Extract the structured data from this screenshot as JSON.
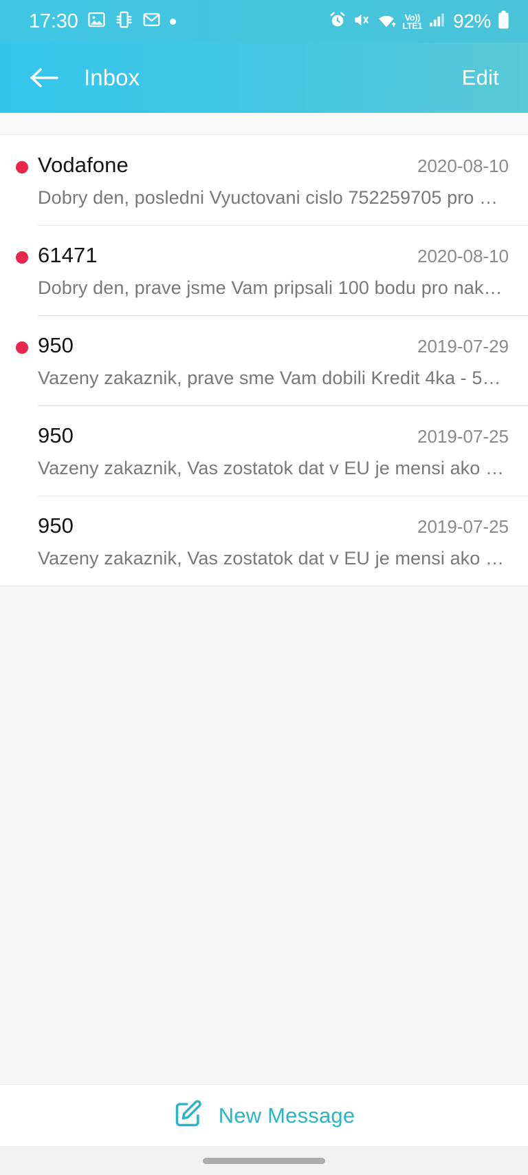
{
  "status_bar": {
    "time": "17:30",
    "left_icons": [
      "image-icon",
      "screen-mirror-icon",
      "gmail-icon",
      "dot-icon"
    ],
    "right_icons": [
      "alarm-icon",
      "mute-vibrate-icon",
      "wifi-icon",
      "volte-icon",
      "signal-bars-icon"
    ],
    "volte_line1": "Vo))",
    "volte_line2": "LTE1",
    "battery_percent": "92%",
    "background_color": "#3fc6e4",
    "foreground_color": "#ffffff"
  },
  "app_bar": {
    "back_icon": "arrow-left-icon",
    "title": "Inbox",
    "edit_label": "Edit",
    "gradient_start": "#35c5ec",
    "gradient_end": "#58c9d6"
  },
  "messages": [
    {
      "sender": "Vodafone",
      "date": "2020-08-10",
      "preview": "Dobry den, posledni Vyuctovani cislo 752259705 pro …",
      "unread": true
    },
    {
      "sender": "61471",
      "date": "2020-08-10",
      "preview": "Dobry den, prave jsme Vam pripsali 100 bodu pro nak…",
      "unread": true
    },
    {
      "sender": "950",
      "date": "2019-07-29",
      "preview": "Vazeny zakaznik, prave sme Vam dobili Kredit 4ka - 5…",
      "unread": true
    },
    {
      "sender": "950",
      "date": "2019-07-25",
      "preview": "Vazeny zakaznik, Vas zostatok dat v EU je mensi ako …",
      "unread": false
    },
    {
      "sender": "950",
      "date": "2019-07-25",
      "preview": "Vazeny zakaznik, Vas zostatok dat v EU je mensi ako …",
      "unread": false
    }
  ],
  "bottom_bar": {
    "compose_icon": "compose-pencil-icon",
    "compose_label": "New Message",
    "accent_color": "#2ab5c4"
  },
  "colors": {
    "unread_dot": "#e8254b",
    "list_background": "#ffffff",
    "empty_background": "#f7f7f7",
    "divider": "#e6e6e6"
  },
  "navigation": {
    "home_indicator": "home-indicator-pill"
  }
}
